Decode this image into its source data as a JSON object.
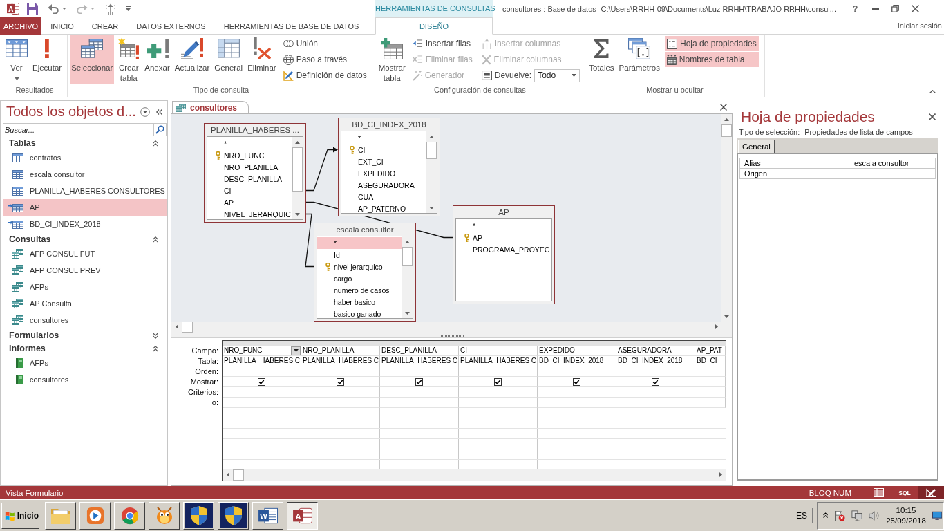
{
  "window": {
    "app_logo": "A",
    "context_group": "HERRAMIENTAS DE CONSULTAS",
    "title": "consultores : Base de datos- C:\\Users\\RRHH-09\\Documents\\Luz RRHH\\TRABAJO RRHH\\consul...",
    "help": "?"
  },
  "ribbon_tabs": [
    {
      "label": "ARCHIVO",
      "kind": "file",
      "selected": false
    },
    {
      "label": "INICIO",
      "kind": "standard",
      "selected": false
    },
    {
      "label": "CREAR",
      "kind": "standard",
      "selected": false
    },
    {
      "label": "DATOS EXTERNOS",
      "kind": "standard",
      "selected": false
    },
    {
      "label": "HERRAMIENTAS DE BASE DE DATOS",
      "kind": "standard",
      "selected": false
    },
    {
      "label": "DISEÑO",
      "kind": "context",
      "selected": true
    }
  ],
  "account": "Iniciar sesión",
  "ribbon_groups": [
    {
      "label": "Resultados",
      "commands": [
        {
          "label": "Ver",
          "kind": "large_menu",
          "selected": false,
          "disabled": false
        },
        {
          "label": "Ejecutar",
          "kind": "large",
          "selected": false,
          "disabled": false
        }
      ]
    },
    {
      "label": "Tipo de consulta",
      "commands": [
        {
          "label": "Seleccionar",
          "kind": "large",
          "selected": true,
          "disabled": false
        },
        {
          "label": "Crear tabla",
          "kind": "large",
          "selected": false,
          "disabled": false
        },
        {
          "label": "Anexar",
          "kind": "large",
          "selected": false,
          "disabled": false
        },
        {
          "label": "Actualizar",
          "kind": "large",
          "selected": false,
          "disabled": false
        },
        {
          "label": "General",
          "kind": "large",
          "selected": false,
          "disabled": false
        },
        {
          "label": "Eliminar",
          "kind": "large",
          "selected": false,
          "disabled": false
        },
        {
          "label": "Unión",
          "kind": "small",
          "selected": false,
          "disabled": false
        },
        {
          "label": "Paso a través",
          "kind": "small",
          "selected": false,
          "disabled": false
        },
        {
          "label": "Definición de datos",
          "kind": "small",
          "selected": false,
          "disabled": false
        }
      ]
    },
    {
      "label": "Configuración de consultas",
      "commands": [
        {
          "label": "Mostrar tabla",
          "kind": "large",
          "selected": false,
          "disabled": false
        },
        {
          "label": "Insertar filas",
          "kind": "small",
          "selected": false,
          "disabled": false
        },
        {
          "label": "Eliminar filas",
          "kind": "small",
          "selected": false,
          "disabled": true
        },
        {
          "label": "Generador",
          "kind": "small",
          "selected": false,
          "disabled": true
        },
        {
          "label": "Insertar columnas",
          "kind": "small",
          "selected": false,
          "disabled": true
        },
        {
          "label": "Eliminar columnas",
          "kind": "small",
          "selected": false,
          "disabled": true
        },
        {
          "label": "Devuelve:",
          "kind": "combo",
          "value": "Todo",
          "selected": false,
          "disabled": false
        }
      ]
    },
    {
      "label": "Mostrar u ocultar",
      "commands": [
        {
          "label": "Totales",
          "kind": "large",
          "selected": false,
          "disabled": false
        },
        {
          "label": "Parámetros",
          "kind": "large",
          "selected": false,
          "disabled": false
        },
        {
          "label": "Hoja de propiedades",
          "kind": "small",
          "selected": true,
          "disabled": false
        },
        {
          "label": "Nombres de tabla",
          "kind": "small",
          "selected": true,
          "disabled": false
        }
      ]
    }
  ],
  "navigation": {
    "title": "Todos los objetos d...",
    "search": {
      "placeholder": "Buscar..."
    },
    "groups": [
      {
        "label": "Tablas",
        "expanded": true,
        "items": [
          {
            "label": "contratos",
            "kind": "table",
            "selected": false
          },
          {
            "label": "escala consultor",
            "kind": "table",
            "selected": false
          },
          {
            "label": "PLANILLA_HABERES CONSULTORES",
            "kind": "table",
            "selected": false
          },
          {
            "label": "AP",
            "kind": "linked_table",
            "selected": true
          },
          {
            "label": "BD_CI_INDEX_2018",
            "kind": "linked_table",
            "selected": false
          }
        ]
      },
      {
        "label": "Consultas",
        "expanded": true,
        "items": [
          {
            "label": "AFP CONSUL FUT",
            "kind": "query",
            "selected": false
          },
          {
            "label": "AFP CONSUL PREV",
            "kind": "query",
            "selected": false
          },
          {
            "label": "AFPs",
            "kind": "query",
            "selected": false
          },
          {
            "label": "AP Consulta",
            "kind": "query",
            "selected": false
          },
          {
            "label": "consultores",
            "kind": "query",
            "selected": false
          }
        ]
      },
      {
        "label": "Formularios",
        "expanded": false
      },
      {
        "label": "Informes",
        "expanded": true,
        "items": [
          {
            "label": "AFPs",
            "kind": "report",
            "selected": false
          },
          {
            "label": "consultores",
            "kind": "report",
            "selected": false
          }
        ]
      }
    ]
  },
  "document": {
    "tab": "consultores",
    "field_lists": [
      {
        "title": "PLANILLA_HABERES ...",
        "fields": [
          {
            "name": "*",
            "key": false,
            "selected": false
          },
          {
            "name": "NRO_FUNC",
            "key": true,
            "selected": false
          },
          {
            "name": "NRO_PLANILLA",
            "key": false,
            "selected": false
          },
          {
            "name": "DESC_PLANILLA",
            "key": false,
            "selected": false
          },
          {
            "name": "CI",
            "key": false,
            "selected": false
          },
          {
            "name": "AP",
            "key": false,
            "selected": false
          },
          {
            "name": "NIVEL_JERARQUIC",
            "key": false,
            "selected": false
          }
        ]
      },
      {
        "title": "BD_CI_INDEX_2018",
        "fields": [
          {
            "name": "*",
            "key": false,
            "selected": false
          },
          {
            "name": "CI",
            "key": true,
            "selected": false
          },
          {
            "name": "EXT_CI",
            "key": false,
            "selected": false
          },
          {
            "name": "EXPEDIDO",
            "key": false,
            "selected": false
          },
          {
            "name": "ASEGURADORA",
            "key": false,
            "selected": false
          },
          {
            "name": "CUA",
            "key": false,
            "selected": false
          },
          {
            "name": "AP_PATERNO",
            "key": false,
            "selected": false
          }
        ]
      },
      {
        "title": "escala consultor",
        "fields": [
          {
            "name": "*",
            "key": false,
            "selected": true
          },
          {
            "name": "Id",
            "key": false,
            "selected": false
          },
          {
            "name": "nivel jerarquico",
            "key": true,
            "selected": false
          },
          {
            "name": "cargo",
            "key": false,
            "selected": false
          },
          {
            "name": "numero de casos",
            "key": false,
            "selected": false
          },
          {
            "name": "haber basico",
            "key": false,
            "selected": false
          },
          {
            "name": "basico ganado",
            "key": false,
            "selected": false
          }
        ]
      },
      {
        "title": "AP",
        "fields": [
          {
            "name": "*",
            "key": false,
            "selected": false
          },
          {
            "name": "AP",
            "key": true,
            "selected": false
          },
          {
            "name": "PROGRAMA_PROYEC",
            "key": false,
            "selected": false
          }
        ]
      }
    ],
    "grid": {
      "row_labels": [
        "Campo:",
        "Tabla:",
        "Orden:",
        "Mostrar:",
        "Criterios:",
        "o:"
      ],
      "columns": [
        {
          "field": "NRO_FUNC",
          "table": "PLANILLA_HABERES C",
          "show": true,
          "active": true
        },
        {
          "field": "NRO_PLANILLA",
          "table": "PLANILLA_HABERES C",
          "show": true,
          "active": false
        },
        {
          "field": "DESC_PLANILLA",
          "table": "PLANILLA_HABERES C",
          "show": true,
          "active": false
        },
        {
          "field": "CI",
          "table": "PLANILLA_HABERES C",
          "show": true,
          "active": false
        },
        {
          "field": "EXPEDIDO",
          "table": "BD_CI_INDEX_2018",
          "show": true,
          "active": false
        },
        {
          "field": "ASEGURADORA",
          "table": "BD_CI_INDEX_2018",
          "show": true,
          "active": false
        },
        {
          "field": "AP_PAT",
          "table": "BD_CI_",
          "active": false
        }
      ]
    }
  },
  "property_sheet": {
    "title": "Hoja de propiedades",
    "selection_type_label": "Tipo de selección:",
    "selection_type": "Propiedades de lista de campos",
    "tabs": [
      {
        "label": "General",
        "selected": true
      }
    ],
    "properties": [
      {
        "name": "Alias",
        "value": "escala consultor"
      },
      {
        "name": "Origen"
      }
    ]
  },
  "status_bar": {
    "text": "Vista Formulario",
    "indicator": "BLOQ NUM",
    "views": [
      {
        "selected": false
      },
      {
        "label": "SQL",
        "selected": false
      },
      {
        "selected": true
      }
    ]
  },
  "taskbar": {
    "start": "Inicio",
    "apps": [
      {
        "selected": false
      },
      {
        "selected": false
      },
      {
        "selected": false
      },
      {
        "selected": false
      },
      {
        "selected": false
      },
      {
        "selected": false
      },
      {
        "logo": "W",
        "selected": false
      },
      {
        "logo": "A",
        "selected": true
      }
    ],
    "language": "ES",
    "time": "10:15",
    "date": "25/09/2018"
  }
}
